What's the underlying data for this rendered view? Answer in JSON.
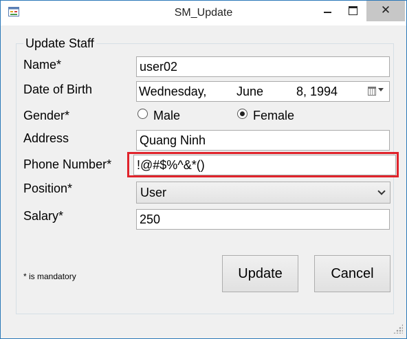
{
  "window": {
    "title": "SM_Update",
    "close_glyph": "✕",
    "icon": "form-app-icon"
  },
  "form": {
    "group_title": "Update Staff",
    "labels": {
      "name": "Name*",
      "dob": "Date of Birth",
      "gender": "Gender*",
      "address": "Address",
      "phone": "Phone Number*",
      "position": "Position*",
      "salary": "Salary*"
    },
    "values": {
      "name": "user02",
      "dob_weekday": "Wednesday,",
      "dob_month": "June",
      "dob_day_year": "8, 1994",
      "address": "Quang Ninh",
      "phone": "!@#$%^&*()",
      "position": "User",
      "salary": "250"
    },
    "gender_options": [
      {
        "label": "Male",
        "checked": false
      },
      {
        "label": "Female",
        "checked": true
      }
    ],
    "mandatory_note": "* is mandatory",
    "buttons": {
      "update": "Update",
      "cancel": "Cancel"
    },
    "highlight_color": "#e0232b"
  }
}
